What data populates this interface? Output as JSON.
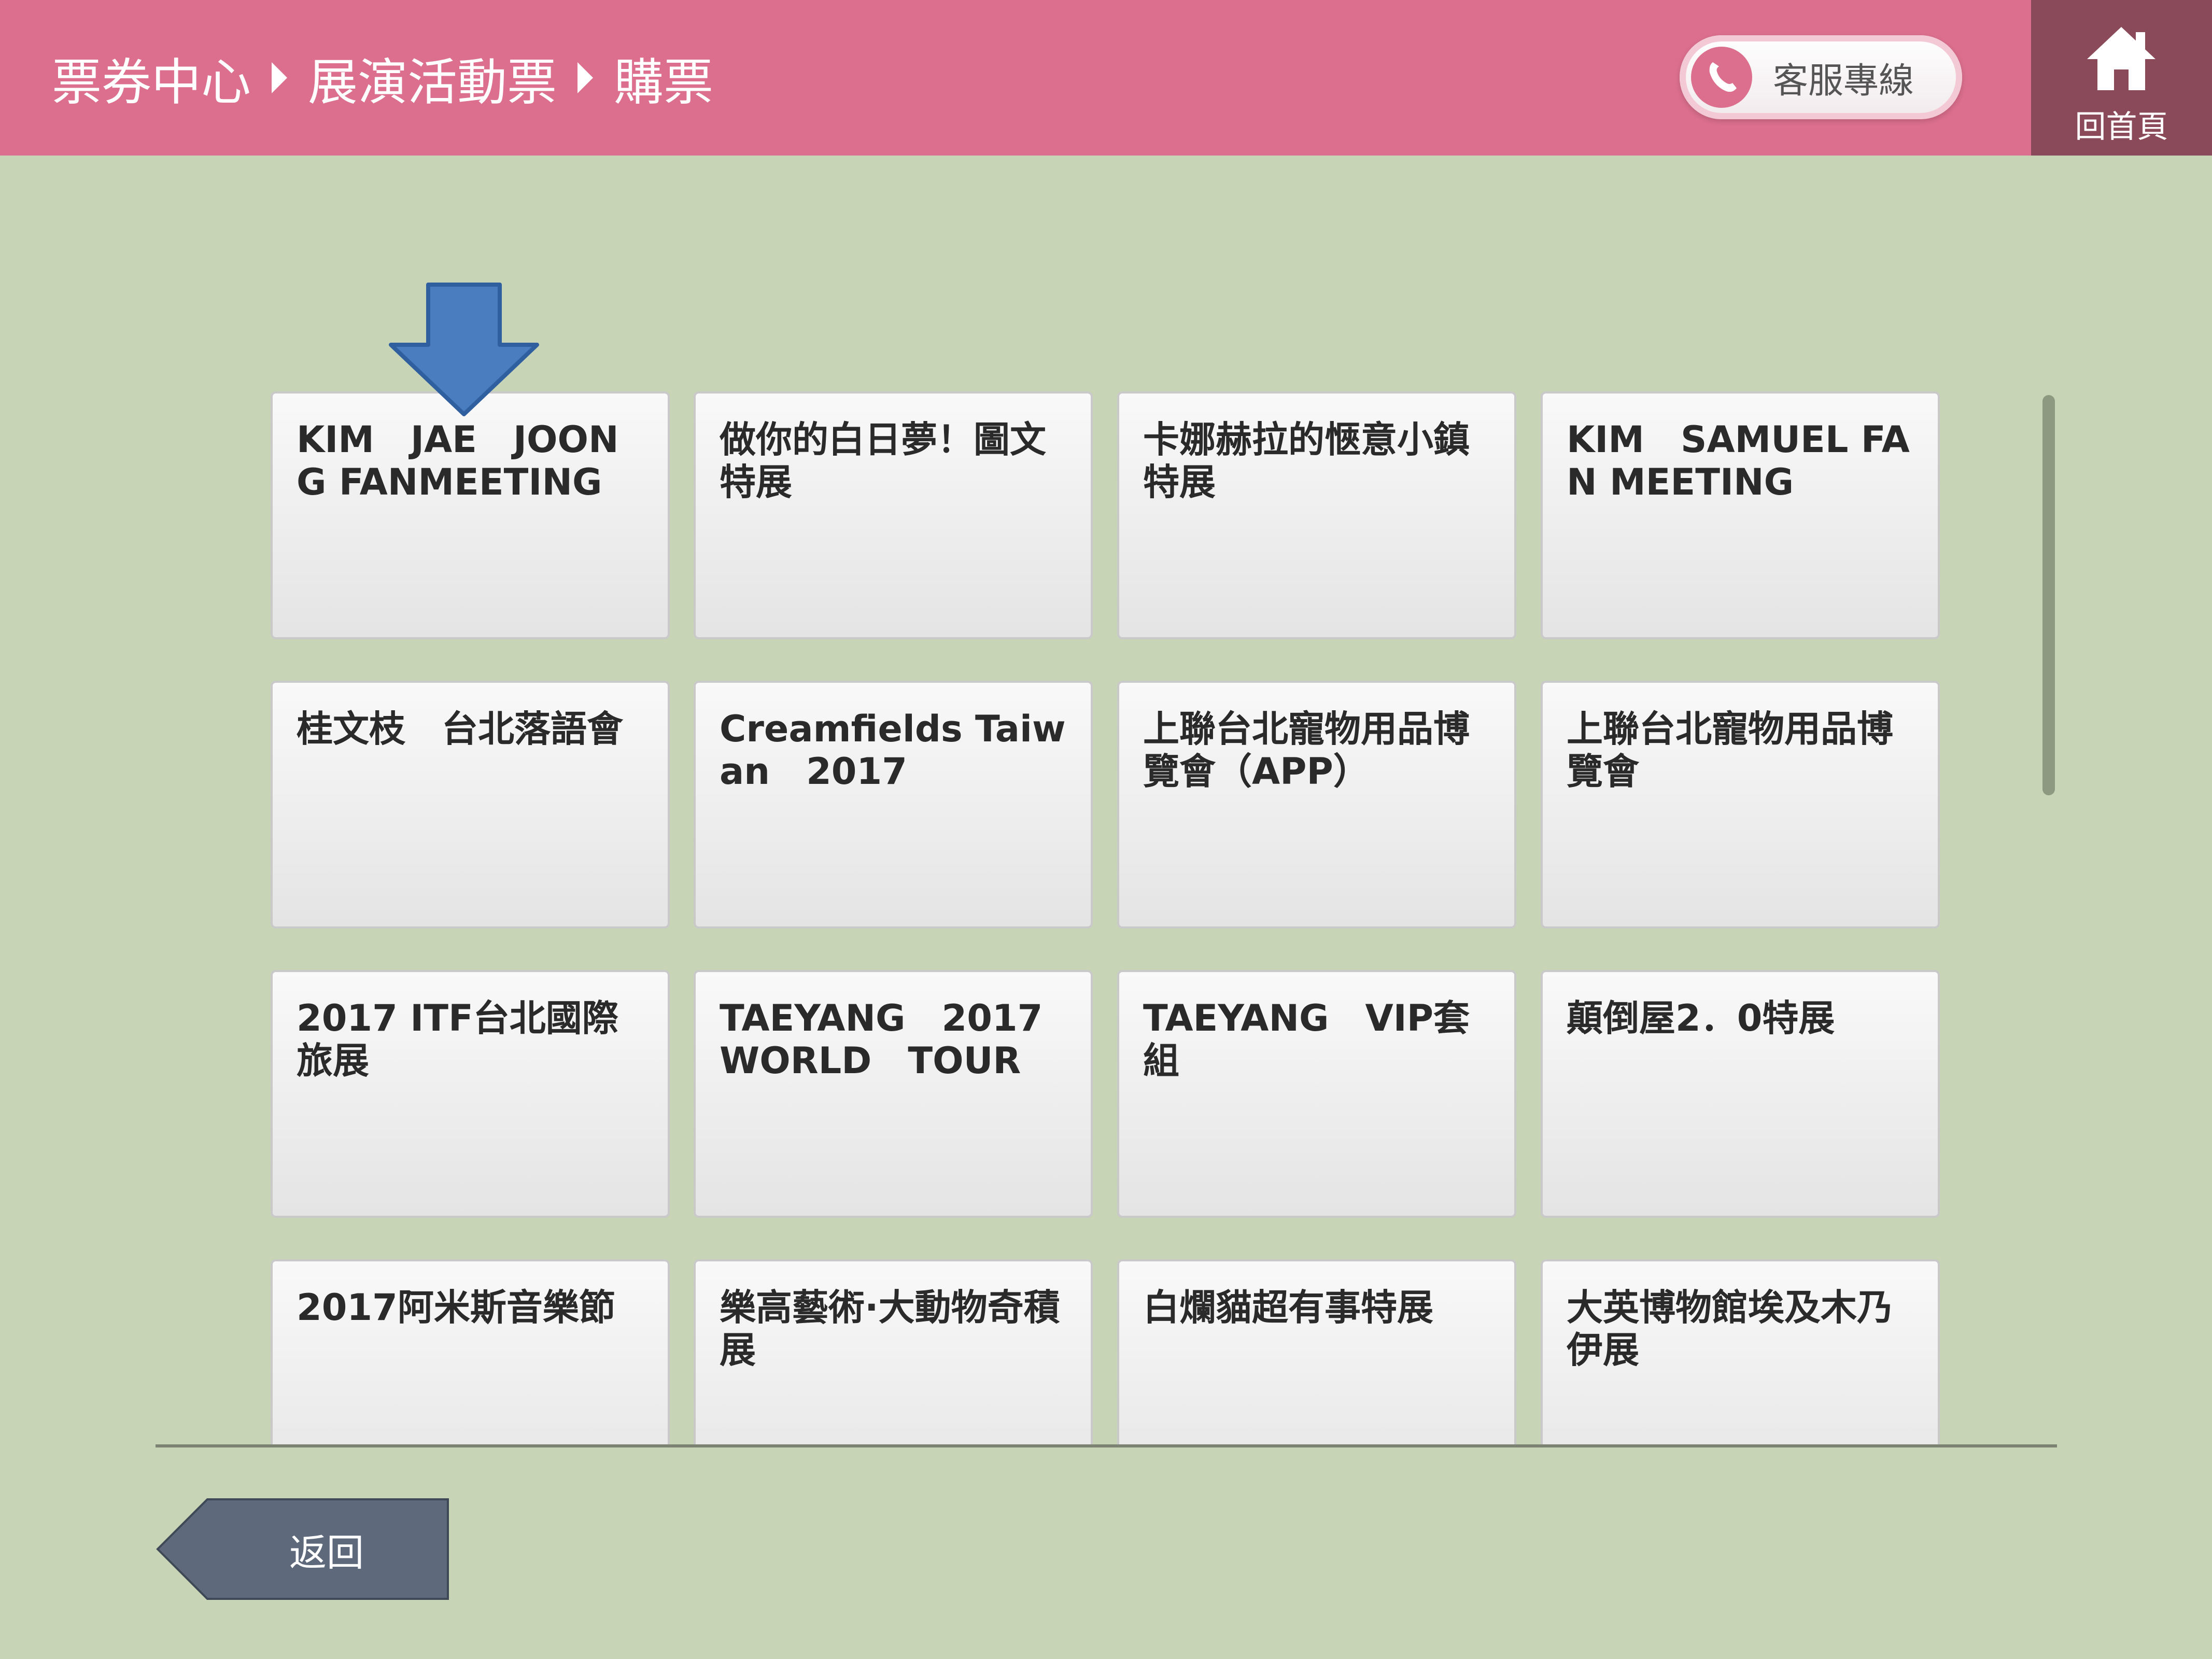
{
  "header": {
    "breadcrumb": [
      "票券中心",
      "展演活動票",
      "購票"
    ],
    "hotline_label": "客服專線",
    "hotline_icon": "phone-icon",
    "home_label": "回首頁",
    "home_icon": "home-icon"
  },
  "events": [
    "KIM　JAE　JOONG FANMEETING",
    "做你的白日夢！圖文特展",
    "卡娜赫拉的愜意小鎮特展",
    "KIM　SAMUEL FAN MEETING",
    "桂文枝　台北落語會",
    "Creamfields Taiwan　2017",
    "上聯台北寵物用品博覽會（APP）",
    "上聯台北寵物用品博覽會",
    "2017 ITF台北國際旅展",
    "TAEYANG　2017 WORLD　TOUR",
    "TAEYANG　VIP套組",
    "顛倒屋2．0特展",
    "2017阿米斯音樂節",
    "樂高藝術·大動物奇積展",
    "白爛貓超有事特展",
    "大英博物館埃及木乃伊展"
  ],
  "footer": {
    "back_label": "返回"
  },
  "colors": {
    "header": "#db6f8d",
    "home_button": "#8b4a5a",
    "background": "#c7d4b6",
    "arrow": "#4a7cc0",
    "back_button": "#5e6a7c"
  }
}
